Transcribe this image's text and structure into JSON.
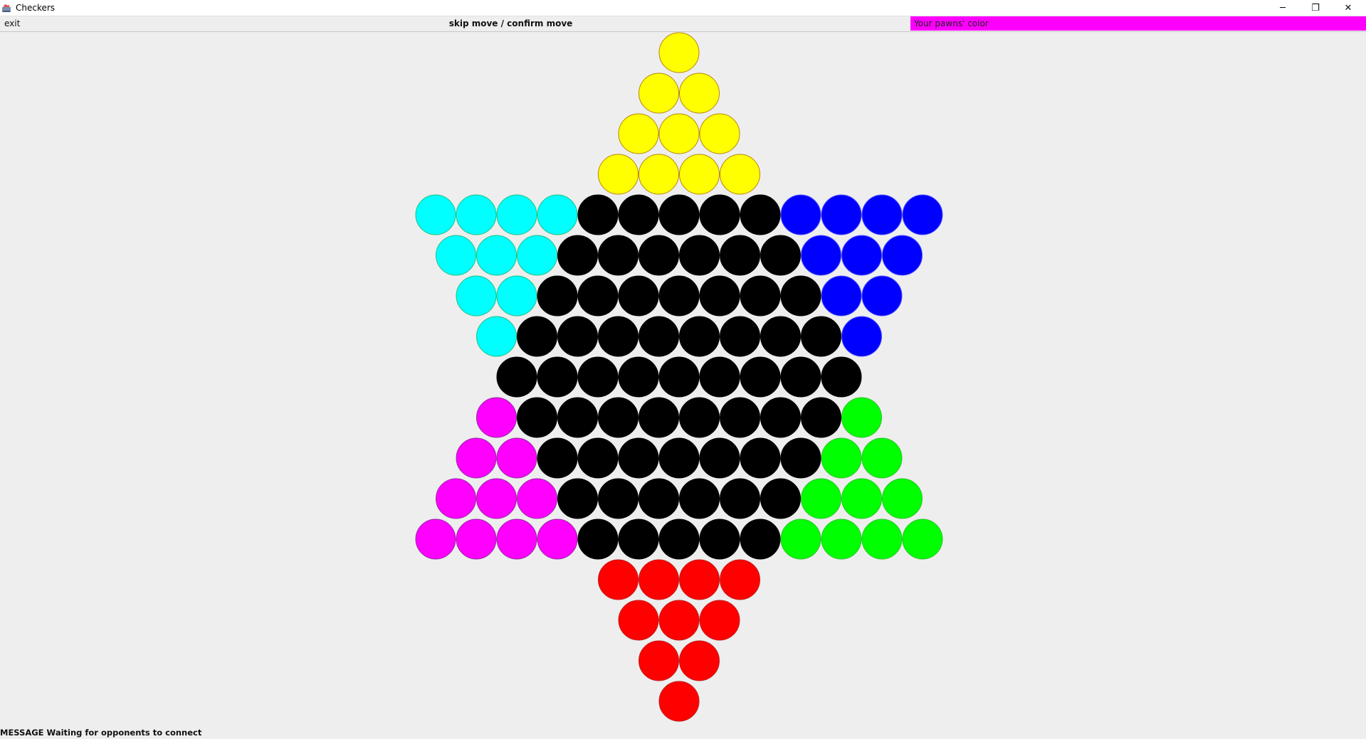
{
  "window": {
    "title": "Checkers",
    "minimize_symbol": "─",
    "restore_symbol": "❐",
    "close_symbol": "✕"
  },
  "toolbar": {
    "exit_label": "exit",
    "skip_confirm_label": "skip move / confirm move",
    "pawn_color_label": "Your pawns' color",
    "pawn_color": "#ff00ff"
  },
  "status": {
    "prefix": "MESSAGE",
    "text": "Waiting for opponents to connect"
  },
  "colors": {
    "yellow": "#ffff00",
    "cyan": "#00ffff",
    "blue": "#0000ff",
    "black": "#000000",
    "magenta": "#ff00ff",
    "green": "#00ff00",
    "red": "#ff0000",
    "background": "#eeeeee"
  },
  "board": {
    "type": "chinese-checkers-star",
    "rows": [
      [
        "yellow"
      ],
      [
        "yellow",
        "yellow"
      ],
      [
        "yellow",
        "yellow",
        "yellow"
      ],
      [
        "yellow",
        "yellow",
        "yellow",
        "yellow"
      ],
      [
        "cyan",
        "cyan",
        "cyan",
        "cyan",
        "black",
        "black",
        "black",
        "black",
        "black",
        "blue",
        "blue",
        "blue",
        "blue"
      ],
      [
        "cyan",
        "cyan",
        "cyan",
        "black",
        "black",
        "black",
        "black",
        "black",
        "black",
        "blue",
        "blue",
        "blue"
      ],
      [
        "cyan",
        "cyan",
        "black",
        "black",
        "black",
        "black",
        "black",
        "black",
        "black",
        "blue",
        "blue"
      ],
      [
        "cyan",
        "black",
        "black",
        "black",
        "black",
        "black",
        "black",
        "black",
        "black",
        "blue"
      ],
      [
        "black",
        "black",
        "black",
        "black",
        "black",
        "black",
        "black",
        "black",
        "black"
      ],
      [
        "magenta",
        "black",
        "black",
        "black",
        "black",
        "black",
        "black",
        "black",
        "black",
        "green"
      ],
      [
        "magenta",
        "magenta",
        "black",
        "black",
        "black",
        "black",
        "black",
        "black",
        "black",
        "green",
        "green"
      ],
      [
        "magenta",
        "magenta",
        "magenta",
        "black",
        "black",
        "black",
        "black",
        "black",
        "black",
        "green",
        "green",
        "green"
      ],
      [
        "magenta",
        "magenta",
        "magenta",
        "magenta",
        "black",
        "black",
        "black",
        "black",
        "black",
        "green",
        "green",
        "green",
        "green"
      ],
      [
        "red",
        "red",
        "red",
        "red"
      ],
      [
        "red",
        "red",
        "red"
      ],
      [
        "red",
        "red"
      ],
      [
        "red"
      ]
    ]
  }
}
